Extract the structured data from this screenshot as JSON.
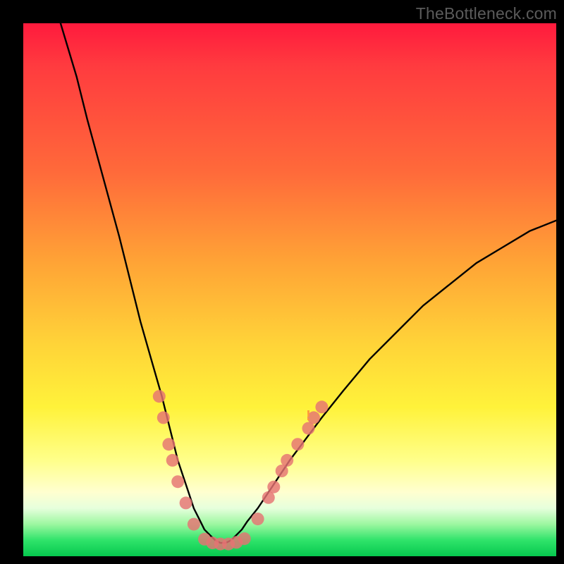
{
  "watermark": "TheBottleneck.com",
  "chart_data": {
    "type": "line",
    "title": "",
    "xlabel": "",
    "ylabel": "",
    "xlim": [
      0,
      100
    ],
    "ylim": [
      0,
      100
    ],
    "curve": {
      "name": "bottleneck-curve",
      "x": [
        7,
        10,
        12,
        15,
        18,
        20,
        22,
        24,
        26,
        27,
        28,
        29,
        30,
        31,
        32,
        33,
        34,
        35,
        36,
        37,
        38,
        39,
        40,
        41,
        42,
        44,
        46,
        48,
        50,
        53,
        56,
        60,
        65,
        70,
        75,
        80,
        85,
        90,
        95,
        100
      ],
      "y": [
        100,
        90,
        82,
        71,
        60,
        52,
        44,
        37,
        30,
        26,
        22,
        18,
        15,
        12,
        9,
        7,
        5,
        4,
        3,
        2.5,
        2.5,
        3,
        4,
        5,
        6.5,
        9,
        12,
        15,
        18,
        22,
        26,
        31,
        37,
        42,
        47,
        51,
        55,
        58,
        61,
        63
      ]
    },
    "markers": {
      "name": "highlight-points",
      "points": [
        {
          "x": 25.5,
          "y": 30
        },
        {
          "x": 26.3,
          "y": 26
        },
        {
          "x": 27.3,
          "y": 21
        },
        {
          "x": 28.0,
          "y": 18
        },
        {
          "x": 29.0,
          "y": 14
        },
        {
          "x": 30.5,
          "y": 10
        },
        {
          "x": 32.0,
          "y": 6
        },
        {
          "x": 34.0,
          "y": 3.2
        },
        {
          "x": 35.5,
          "y": 2.5
        },
        {
          "x": 37.0,
          "y": 2.3
        },
        {
          "x": 38.5,
          "y": 2.3
        },
        {
          "x": 40.0,
          "y": 2.6
        },
        {
          "x": 41.5,
          "y": 3.3
        },
        {
          "x": 44.0,
          "y": 7
        },
        {
          "x": 46.0,
          "y": 11
        },
        {
          "x": 47.0,
          "y": 13
        },
        {
          "x": 48.5,
          "y": 16
        },
        {
          "x": 49.5,
          "y": 18
        },
        {
          "x": 51.5,
          "y": 21
        },
        {
          "x": 53.5,
          "y": 24
        },
        {
          "x": 54.5,
          "y": 26
        },
        {
          "x": 56.0,
          "y": 28
        }
      ]
    },
    "annotations": [
      {
        "x": 53.5,
        "y": 25.5,
        "text": "!",
        "color": "#ff9a3a"
      }
    ]
  }
}
